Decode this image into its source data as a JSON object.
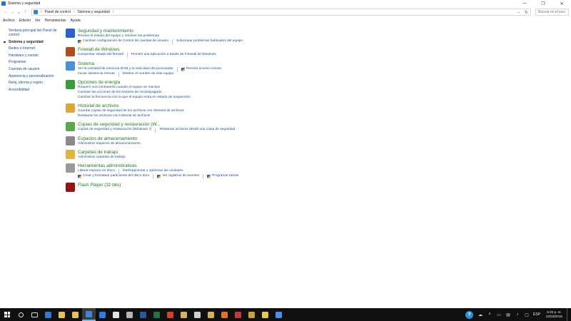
{
  "window": {
    "title": "Sistema y seguridad",
    "controls": {
      "minimize": "—",
      "maximize": "❐",
      "close": "✕"
    }
  },
  "address": {
    "breadcrumb": [
      "Panel de control",
      "Sistema y seguridad"
    ],
    "separator": "›",
    "search_placeholder": "Buscar en el panel..."
  },
  "menu": [
    "Archivo",
    "Edición",
    "Ver",
    "Herramientas",
    "Ayuda"
  ],
  "sidebar": {
    "items": [
      {
        "label": "Ventana principal del Panel de control",
        "active": false
      },
      {
        "label": "Sistema y seguridad",
        "active": true
      },
      {
        "label": "Redes e Internet",
        "active": false
      },
      {
        "label": "Hardware y sonido",
        "active": false
      },
      {
        "label": "Programas",
        "active": false
      },
      {
        "label": "Cuentas de usuario",
        "active": false
      },
      {
        "label": "Apariencia y personalización",
        "active": false
      },
      {
        "label": "Reloj, idioma y región",
        "active": false
      },
      {
        "label": "Accesibilidad",
        "active": false
      }
    ]
  },
  "categories": [
    {
      "title": "Seguridad y mantenimiento",
      "icon": "flag-icon",
      "icon_color": "#2a62c9",
      "lines": [
        [
          {
            "label": "Revisar el estado del equipo y resolver los problemas"
          }
        ],
        [
          {
            "label": "Cambiar configuración de Control de cuentas de usuario",
            "shield": true
          },
          {
            "label": "Solucionar problemas habituales del equipo"
          }
        ]
      ]
    },
    {
      "title": "Firewall de Windows",
      "icon": "firewall-icon",
      "icon_color": "#b04d1e",
      "lines": [
        [
          {
            "label": "Comprobar estado del firewall"
          },
          {
            "label": "Permitir una aplicación a través de Firewall de Windows"
          }
        ]
      ]
    },
    {
      "title": "Sistema",
      "icon": "computer-icon",
      "icon_color": "#4a90d9",
      "lines": [
        [
          {
            "label": "Ver la cantidad de memoria RAM y la velocidad del procesador"
          },
          {
            "label": "Permitir acceso remoto",
            "shield": true
          }
        ],
        [
          {
            "label": "Iniciar asistencia remota"
          },
          {
            "label": "Mostrar el nombre de este equipo"
          }
        ]
      ]
    },
    {
      "title": "Opciones de energía",
      "icon": "power-icon",
      "icon_color": "#3c9b3c",
      "lines": [
        [
          {
            "label": "Requerir una contraseña cuando el equipo se reactive"
          }
        ],
        [
          {
            "label": "Cambiar las acciones de los botones de inicio/apagado"
          }
        ],
        [
          {
            "label": "Cambiar la frecuencia con la que el equipo entra en estado de suspensión"
          }
        ]
      ]
    },
    {
      "title": "Historial de archivos",
      "icon": "file-history-icon",
      "icon_color": "#d8a93a",
      "lines": [
        [
          {
            "label": "Guardar copias de seguridad de los archivos con Historial de archivos"
          }
        ],
        [
          {
            "label": "Restaurar los archivos con Historial de archivos"
          }
        ]
      ]
    },
    {
      "title": "Copias de seguridad y restauración (W...",
      "icon": "backup-icon",
      "icon_color": "#5aa84a",
      "lines": [
        [
          {
            "label": "Copias de seguridad y restauración (Windows 7)"
          },
          {
            "label": "Restaurar archivos desde una copia de seguridad"
          }
        ]
      ]
    },
    {
      "title": "Espacios de almacenamiento",
      "icon": "storage-icon",
      "icon_color": "#8a8a8a",
      "lines": [
        [
          {
            "label": "Administrar espacios de almacenamiento"
          }
        ]
      ]
    },
    {
      "title": "Carpetas de trabajo",
      "icon": "work-folders-icon",
      "icon_color": "#e0b441",
      "lines": [
        [
          {
            "label": "Administrar carpetas de trabajo"
          }
        ]
      ]
    },
    {
      "title": "Herramientas administrativas",
      "icon": "admin-tools-icon",
      "icon_color": "#9a9a9a",
      "lines": [
        [
          {
            "label": "Liberar espacio en disco"
          },
          {
            "label": "Desfragmentar y optimizar las unidades"
          }
        ],
        [
          {
            "label": "Crear y formatear particiones del disco duro",
            "shield": true
          },
          {
            "label": "Ver registros de eventos",
            "shield": true
          },
          {
            "label": "Programar tareas",
            "shield": true
          }
        ]
      ]
    },
    {
      "title": "Flash Player (32 bits)",
      "icon": "flash-player-icon",
      "icon_color": "#8f1414",
      "lines": []
    }
  ],
  "taskbar": {
    "apps": [
      {
        "name": "search-icon",
        "color": "#101010"
      },
      {
        "name": "task-view-icon",
        "color": "#101010"
      },
      {
        "name": "edge-icon",
        "color": "#2b7cd3"
      },
      {
        "name": "file-explorer-icon",
        "color": "#e8c14c"
      },
      {
        "name": "file-explorer-icon-2",
        "color": "#e8c14c"
      },
      {
        "name": "control-panel-icon",
        "color": "#3f87d8",
        "active": true
      },
      {
        "name": "store-icon",
        "color": "#2a7de1"
      },
      {
        "name": "office-icon",
        "color": "#e5e5e5"
      },
      {
        "name": "photos-icon",
        "color": "#b5b5b5"
      },
      {
        "name": "word-icon",
        "color": "#2b579a"
      },
      {
        "name": "excel-icon",
        "color": "#217346"
      },
      {
        "name": "powerpoint-icon",
        "color": "#d04423"
      },
      {
        "name": "paint-icon",
        "color": "#d6b35a"
      },
      {
        "name": "calculator-icon",
        "color": "#d0d0d0"
      },
      {
        "name": "folder-icon",
        "color": "#d9b24e"
      },
      {
        "name": "media-player-icon",
        "color": "#e0712c"
      },
      {
        "name": "snipping-icon",
        "color": "#c23a3a"
      },
      {
        "name": "photo-viewer-icon",
        "color": "#c9a03b"
      },
      {
        "name": "notes-icon",
        "color": "#e6cc4d"
      },
      {
        "name": "chrome-icon",
        "color": "#4a90e2"
      }
    ],
    "tray": {
      "lang": "ESP",
      "time": "6:20 p. m.",
      "date": "22/03/2016"
    }
  }
}
